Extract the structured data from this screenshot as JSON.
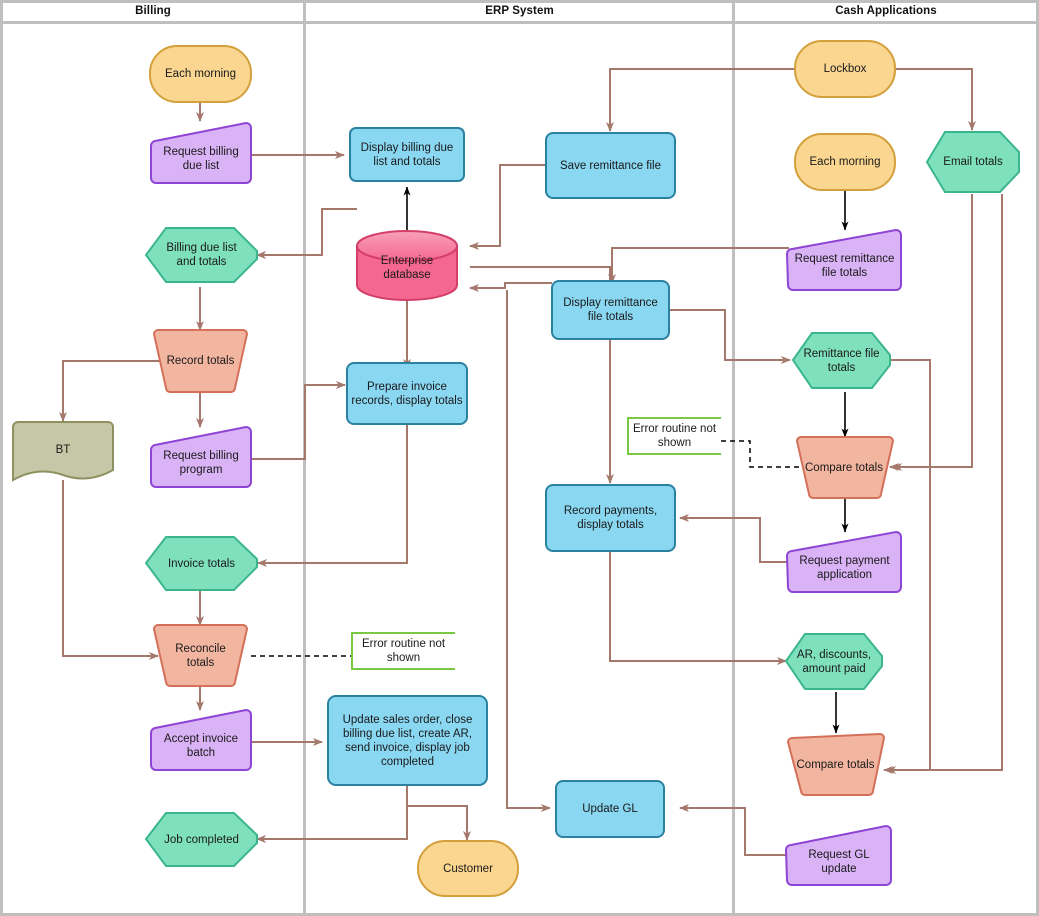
{
  "diagram": {
    "title": "Billing / ERP / Cash Applications cross-functional flowchart",
    "lanes": [
      {
        "id": "billing",
        "label": "Billing"
      },
      {
        "id": "erp",
        "label": "ERP System"
      },
      {
        "id": "cash",
        "label": "Cash Applications"
      }
    ],
    "colors": {
      "terminator_fill": "#fad690",
      "terminator_stroke": "#d4a03c",
      "manual_input_fill": "#d9b3f5",
      "manual_input_stroke": "#8e44d4",
      "data_fill": "#7fe0bd",
      "data_stroke": "#3bb68c",
      "process_fill": "#8ad7f2",
      "process_stroke": "#2a82a0",
      "manual_op_fill": "#f2b5a0",
      "manual_op_stroke": "#d4705a",
      "database_fill": "#f4688f",
      "database_stroke": "#d43f6a",
      "document_fill": "#c5c8a6",
      "document_stroke": "#8f9260",
      "note_stroke": "#7ac943",
      "connector": "#a5786c",
      "connector_black": "#000000",
      "lane_border": "#bfbfbf"
    },
    "nodes": [
      {
        "id": "each-morning-billing",
        "label": "Each morning",
        "shape": "terminator",
        "lane": "billing"
      },
      {
        "id": "request-billing-due-list",
        "label": "Request billing\ndue list",
        "shape": "manual-input",
        "lane": "billing"
      },
      {
        "id": "billing-due-list-and-totals",
        "label": "Billing due list\nand totals",
        "shape": "data",
        "lane": "billing"
      },
      {
        "id": "record-totals",
        "label": "Record totals",
        "shape": "manual-operation",
        "lane": "billing"
      },
      {
        "id": "bt",
        "label": "BT",
        "shape": "document",
        "lane": "billing"
      },
      {
        "id": "request-billing-program",
        "label": "Request billing\nprogram",
        "shape": "manual-input",
        "lane": "billing"
      },
      {
        "id": "invoice-totals",
        "label": "Invoice totals",
        "shape": "data",
        "lane": "billing"
      },
      {
        "id": "reconcile-totals",
        "label": "Reconcile\ntotals",
        "shape": "manual-operation",
        "lane": "billing"
      },
      {
        "id": "accept-invoice-batch",
        "label": "Accept invoice\nbatch",
        "shape": "manual-input",
        "lane": "billing"
      },
      {
        "id": "job-completed",
        "label": "Job completed",
        "shape": "data",
        "lane": "billing"
      },
      {
        "id": "display-billing-due-list-and-totals",
        "label": "Display billing due\nlist and totals",
        "shape": "process",
        "lane": "erp"
      },
      {
        "id": "save-remittance-file",
        "label": "Save remittance file",
        "shape": "process",
        "lane": "erp"
      },
      {
        "id": "enterprise-database",
        "label": "Enterprise\ndatabase",
        "shape": "database",
        "lane": "erp"
      },
      {
        "id": "display-remittance-file-totals",
        "label": "Display remittance\nfile totals",
        "shape": "process",
        "lane": "erp"
      },
      {
        "id": "prepare-invoice-records",
        "label": "Prepare invoice\nrecords, display totals",
        "shape": "process",
        "lane": "erp"
      },
      {
        "id": "error-routine-note-upper",
        "label": "Error routine not\nshown",
        "shape": "note",
        "lane": "erp"
      },
      {
        "id": "record-payments-display-totals",
        "label": "Record payments,\ndisplay totals",
        "shape": "process",
        "lane": "erp"
      },
      {
        "id": "error-routine-note-lower",
        "label": "Error routine not\nshown",
        "shape": "note",
        "lane": "erp"
      },
      {
        "id": "update-sales-order",
        "label": "Update sales order, close\nbilling due list, create AR,\nsend invoice, display job\ncompleted",
        "shape": "process",
        "lane": "erp"
      },
      {
        "id": "update-gl",
        "label": "Update GL",
        "shape": "process",
        "lane": "erp"
      },
      {
        "id": "customer",
        "label": "Customer",
        "shape": "terminator",
        "lane": "erp"
      },
      {
        "id": "lockbox",
        "label": "Lockbox",
        "shape": "terminator",
        "lane": "cash"
      },
      {
        "id": "each-morning-cash",
        "label": "Each morning",
        "shape": "terminator",
        "lane": "cash"
      },
      {
        "id": "email-totals",
        "label": "Email totals",
        "shape": "data",
        "lane": "cash"
      },
      {
        "id": "request-remittance-file-totals",
        "label": "Request remittance\nfile totals",
        "shape": "manual-input",
        "lane": "cash"
      },
      {
        "id": "remittance-file-totals",
        "label": "Remittance file\ntotals",
        "shape": "data",
        "lane": "cash"
      },
      {
        "id": "compare-totals-upper",
        "label": "Compare totals",
        "shape": "manual-operation",
        "lane": "cash"
      },
      {
        "id": "request-payment-application",
        "label": "Request payment\napplication",
        "shape": "manual-input",
        "lane": "cash"
      },
      {
        "id": "ar-discounts-amount-paid",
        "label": "AR, discounts,\namount paid",
        "shape": "data",
        "lane": "cash"
      },
      {
        "id": "compare-totals-lower",
        "label": "Compare totals",
        "shape": "manual-operation",
        "lane": "cash"
      },
      {
        "id": "request-gl-update",
        "label": "Request GL\nupdate",
        "shape": "manual-input",
        "lane": "cash"
      }
    ]
  }
}
